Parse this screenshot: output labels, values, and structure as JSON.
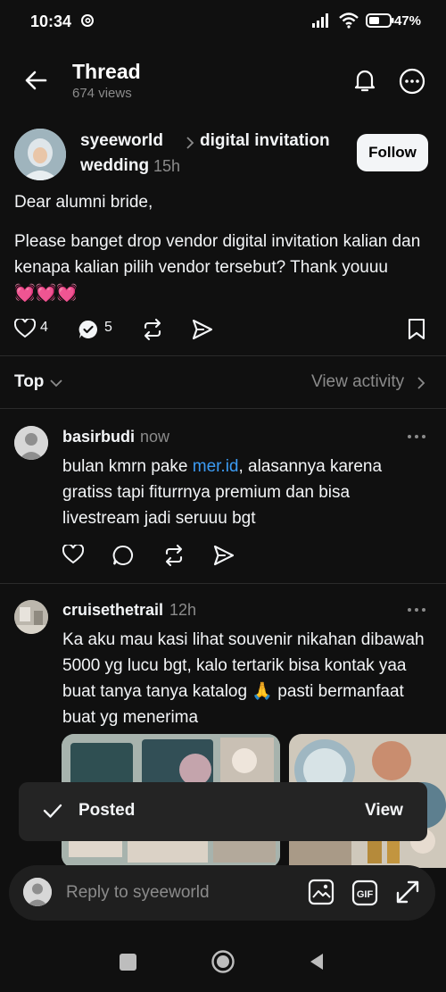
{
  "status_bar": {
    "time": "10:34",
    "battery": "47%"
  },
  "header": {
    "title": "Thread",
    "views": "674 views"
  },
  "post": {
    "username": "syeeworld",
    "topic_line1": "digital invitation",
    "topic_line2": "wedding",
    "time": "15h",
    "follow_label": "Follow",
    "text_p1": "Dear alumni bride,",
    "text_p2": "Please banget drop vendor digital invitation kalian dan kenapa kalian pilih vendor tersebut? Thank youuu",
    "hearts": "💓💓💓",
    "likes": "4",
    "replies": "5"
  },
  "sort": {
    "label": "Top",
    "view_activity": "View activity"
  },
  "replies": [
    {
      "username": "basirbudi",
      "time": "now",
      "text_before": "bulan kmrn pake ",
      "link": "mer.id",
      "text_after": ", alasannya karena gratiss tapi fiturrnya premium dan bisa livestream jadi seruuu bgt"
    },
    {
      "username": "cruisethetrail",
      "time": "12h",
      "text": "Ka aku mau kasi lihat souvenir nikahan dibawah 5000 yg lucu bgt, kalo tertarik bisa kontak yaa buat tanya tanya katalog 🙏 pasti bermanfaat buat yg menerima"
    }
  ],
  "snackbar": {
    "text": "Posted",
    "action": "View"
  },
  "composer": {
    "placeholder": "Reply to syeeworld",
    "gif_label": "GIF"
  }
}
